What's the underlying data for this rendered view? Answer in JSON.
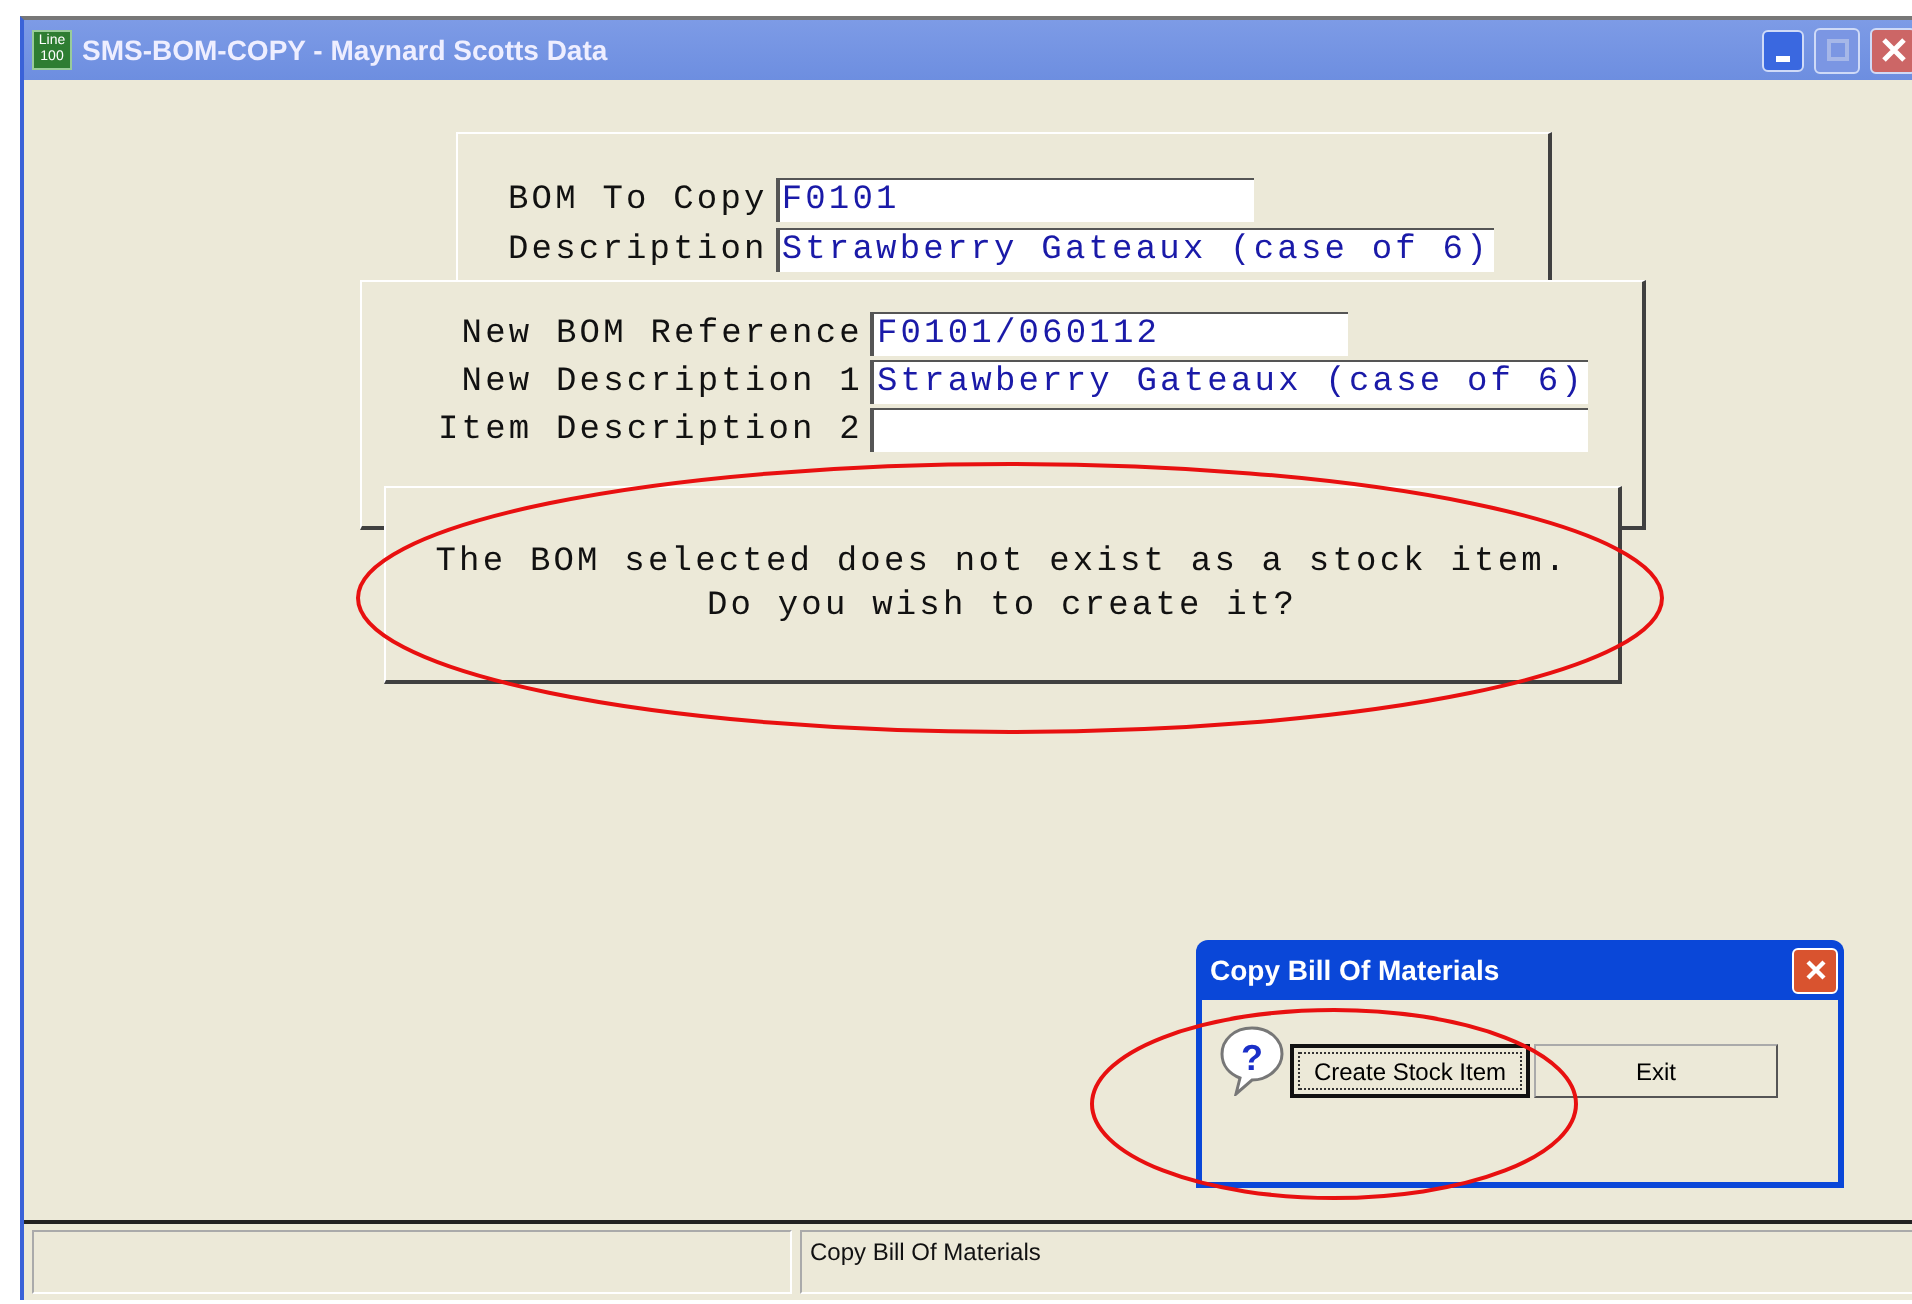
{
  "window": {
    "title": "SMS-BOM-COPY - Maynard Scotts Data",
    "app_badge": "Line 100"
  },
  "source_panel": {
    "fields": [
      {
        "label": "BOM To Copy",
        "value": "F0101",
        "wide": false
      },
      {
        "label": "Description",
        "value": "Strawberry Gateaux (case of 6)",
        "wide": true
      }
    ]
  },
  "new_panel": {
    "fields": [
      {
        "label": "New BOM Reference",
        "value": "F0101/060112",
        "wide": false
      },
      {
        "label": "New Description 1",
        "value": "Strawberry Gateaux (case of 6)",
        "wide": true
      },
      {
        "label": "Item Description 2",
        "wide": true
      }
    ]
  },
  "message": {
    "lines": [
      "The BOM selected does not exist as a stock item.",
      "Do you wish to create it?"
    ]
  },
  "dialog": {
    "title": "Copy Bill Of Materials",
    "icon_text": "?",
    "buttons": [
      {
        "label": "Create Stock Item",
        "focused": true
      },
      {
        "label": "Exit",
        "focused": false
      }
    ]
  },
  "status_bar": {
    "text": "Copy Bill Of Materials"
  }
}
